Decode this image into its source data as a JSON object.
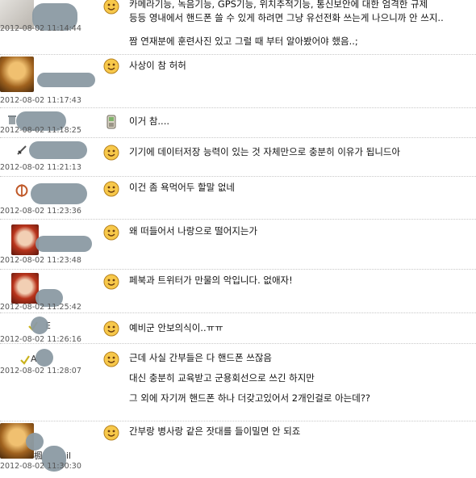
{
  "comments": [
    {
      "timestamp": "2012-08-02 11:14:44",
      "icon": "smiley-icon",
      "lines": [
        "카메라기능, 녹음기능, GPS기능, 위치추적기능, 통신보안에 대한 엄격한 규제",
        "등등 영내에서 핸드폰 쓸 수 있게 하려면 그냥 유선전화 쓰는게 나으니까 안 쓰지..",
        "짬 연재분에 훈련사진 있고 그럴 때 부터 알아봤어야 했음..;"
      ]
    },
    {
      "timestamp": "2012-08-02 11:17:43",
      "icon": "smiley-icon",
      "lines": [
        "사상이 참 허허"
      ]
    },
    {
      "timestamp": "2012-08-02 11:18:25",
      "icon": "phone-icon",
      "lines": [
        "이거 참...."
      ]
    },
    {
      "timestamp": "2012-08-02 11:21:13",
      "icon": "smiley-icon",
      "lines": [
        "기기에 데이터저장 능력이 있는 것 자체만으로 충분히 이유가 됩니드아"
      ]
    },
    {
      "timestamp": "2012-08-02 11:23:36",
      "icon": "smiley-icon",
      "lines": [
        "이건 좀 욕먹어두 할말 없네"
      ]
    },
    {
      "timestamp": "2012-08-02 11:23:48",
      "icon": "smiley-icon",
      "lines": [
        "왜 떠들어서 나랑으로 떨어지는가"
      ]
    },
    {
      "timestamp": "2012-08-02 11:25:42",
      "icon": "smiley-icon",
      "lines": [
        "페북과 트위터가 만물의 악입니다. 없애자!"
      ]
    },
    {
      "timestamp": "2012-08-02 11:26:16",
      "icon": "smiley-icon",
      "lines": [
        "예비군 안보의식이..ㅠㅠ"
      ]
    },
    {
      "timestamp": "2012-08-02 11:28:07",
      "icon": "smiley-icon",
      "lines": [
        "근데 사실 간부들은 다 핸드폰 쓰잖음",
        "대신 충분히 교육받고 군용회선으로 쓰긴 하지만",
        "그 외에 자기꺼 핸드폰 하나 더갖고있어서 2개인걸로 아는데??"
      ]
    },
    {
      "timestamp": "2012-08-02 11:30:30",
      "icon": "smiley-icon",
      "lines": [
        "간부랑 병사랑 같은 잣대를 들이밀면 안 되죠"
      ]
    }
  ],
  "visible_name_fragments": [
    "E",
    "A",
    "楓",
    "il"
  ]
}
